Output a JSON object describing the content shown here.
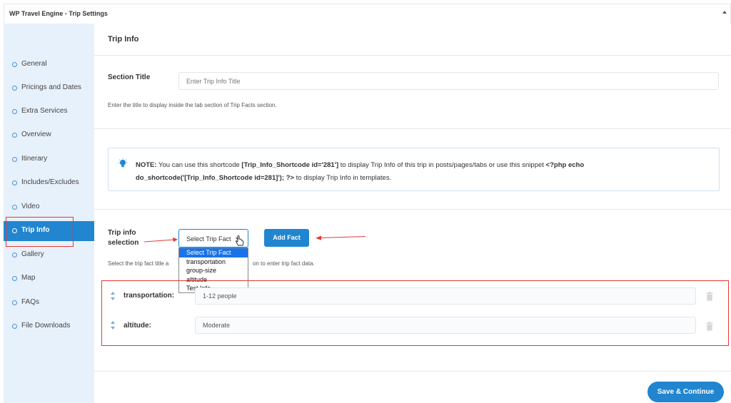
{
  "panel": {
    "title": "WP Travel Engine - Trip Settings"
  },
  "sidebar": {
    "items": [
      {
        "label": "General",
        "active": false
      },
      {
        "label": "Pricings and Dates",
        "active": false
      },
      {
        "label": "Extra Services",
        "active": false
      },
      {
        "label": "Overview",
        "active": false
      },
      {
        "label": "Itinerary",
        "active": false
      },
      {
        "label": "Includes/Excludes",
        "active": false
      },
      {
        "label": "Video",
        "active": false
      },
      {
        "label": "Trip Info",
        "active": true
      },
      {
        "label": "Gallery",
        "active": false
      },
      {
        "label": "Map",
        "active": false
      },
      {
        "label": "FAQs",
        "active": false
      },
      {
        "label": "File Downloads",
        "active": false
      }
    ]
  },
  "main": {
    "title": "Trip Info",
    "section_title": {
      "label": "Section Title",
      "placeholder": "Enter Trip Info Title",
      "help": "Enter the title to display inside the tab section of Trip Facts section."
    },
    "note": {
      "prefix": "NOTE:",
      "text_1": " You can use this shortcode ",
      "shortcode": "[Trip_Info_Shortcode id='281']",
      "text_2": " to display Trip Info of this trip in posts/pages/tabs or use this snippet ",
      "snippet": "<?php echo do_shortcode('[Trip_Info_Shortcode id=281]'); ?>",
      "text_3": " to display Trip Info in templates."
    },
    "selection": {
      "label_line1": "Trip info",
      "label_line2": "selection",
      "selected": "Select Trip Fact",
      "options": [
        "Select Trip Fact",
        "transportation",
        "group-size",
        "altitude",
        "Test Info"
      ],
      "add_button": "Add Fact",
      "help_left": "Select the trip fact title a",
      "help_right": "on to enter trip fact data."
    },
    "facts": [
      {
        "label": "transportation:",
        "value": "1-12 people"
      },
      {
        "label": "altitude:",
        "value": "Moderate"
      }
    ],
    "save_button": "Save & Continue"
  },
  "colors": {
    "accent": "#2185d0",
    "sidebar_bg": "#e7f1fb",
    "annotation_red": "#e53935"
  }
}
